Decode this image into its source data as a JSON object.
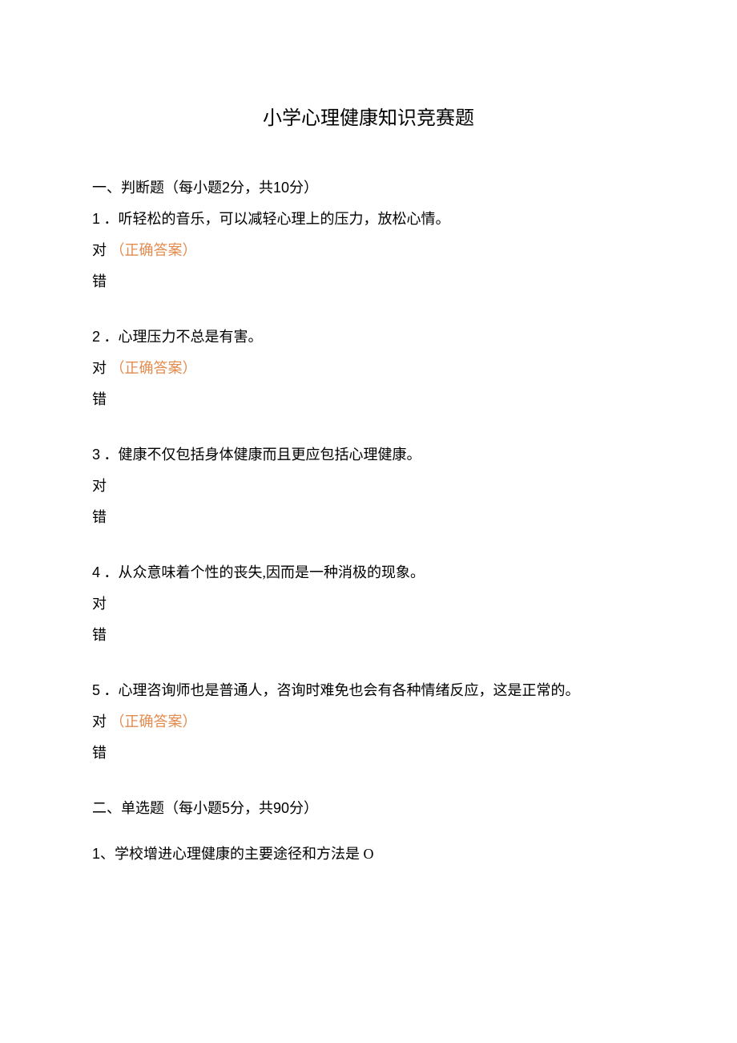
{
  "title": "小学心理健康知识竞赛题",
  "section1": {
    "header_prefix": "一、判断题（每小题",
    "header_points": "2",
    "header_mid": "分，共",
    "header_total": "10",
    "header_suffix": "分）"
  },
  "q1": {
    "num": "1",
    "text": " ．听轻松的音乐，可以减轻心理上的压力，放松心情。",
    "opt_true": "对 ",
    "correct": "（正确答案）",
    "opt_false": "错"
  },
  "q2": {
    "num": "2",
    "text": " ．心理压力不总是有害。",
    "opt_true": "对 ",
    "correct": "（正确答案）",
    "opt_false": "错"
  },
  "q3": {
    "num": "3",
    "text": " ．健康不仅包括身体健康而且更应包括心理健康。",
    "opt_true": "对",
    "opt_false": "错"
  },
  "q4": {
    "num": "4",
    "text": " ．从众意味着个性的丧失,因而是一种消极的现象。",
    "opt_true": "对",
    "opt_false": "错"
  },
  "q5": {
    "num": "5",
    "text": " ．心理咨询师也是普通人，咨询时难免也会有各种情绪反应，这是正常的。",
    "opt_true": "对 ",
    "correct": "（正确答案）",
    "opt_false": "错"
  },
  "section2": {
    "header_prefix": "二、单选题（每小题",
    "header_points": "5",
    "header_mid": "分，共",
    "header_total": "90",
    "header_suffix": "分）"
  },
  "s2q1": {
    "num": "1",
    "text": "、学校增进心理健康的主要途径和方法是 O"
  }
}
